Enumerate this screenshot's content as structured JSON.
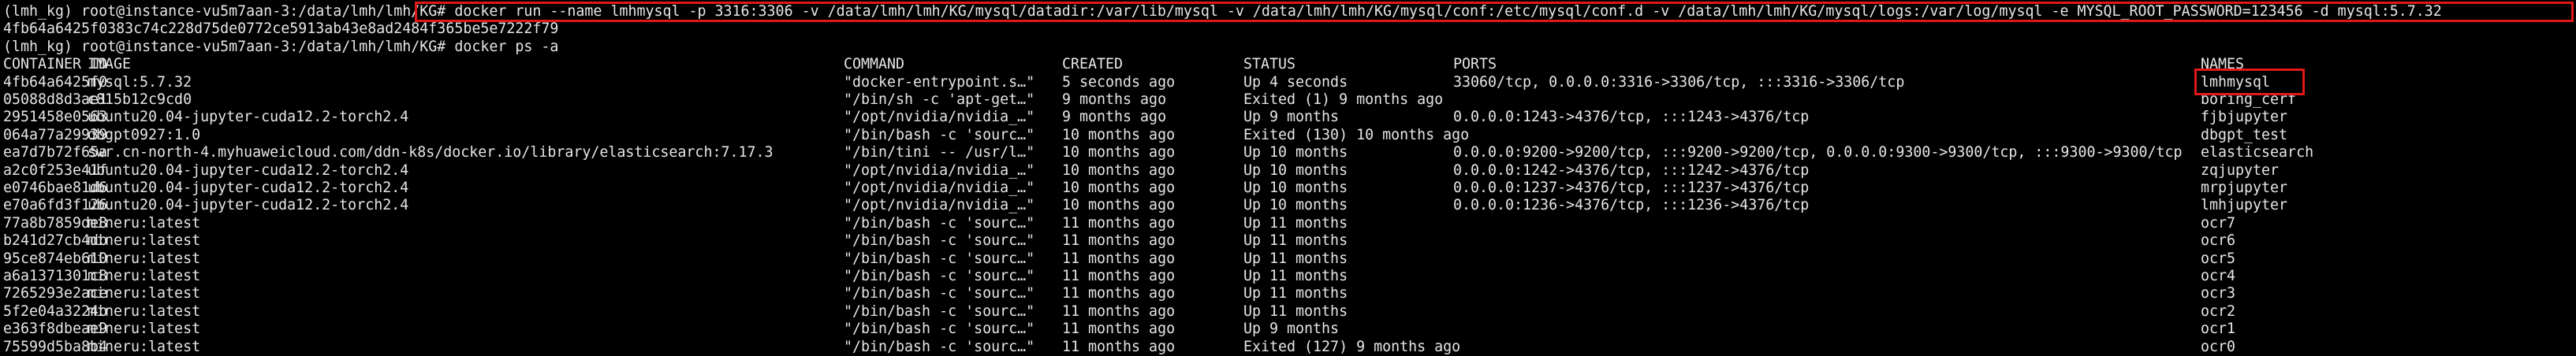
{
  "terminal": {
    "highlight_color": "#e01818",
    "line1_prompt": "(lmh_kg) root@instance-vu5m7aan-3:/data/lmh/lmh/KG# ",
    "line1_command": "docker run --name lmhmysql -p 3316:3306 -v /data/lmh/lmh/KG/mysql/datadir:/var/lib/mysql -v /data/lmh/lmh/KG/mysql/conf:/etc/mysql/conf.d -v /data/lmh/lmh/KG/mysql/logs:/var/log/mysql -e MYSQL_ROOT_PASSWORD=123456 -d mysql:5.7.32",
    "container_hash": "4fb64a6425f0383c74c228d75de0772ce5913ab43e8ad2484f365be5e7222f79",
    "line3": "(lmh_kg) root@instance-vu5m7aan-3:/data/lmh/lmh/KG# docker ps -a",
    "columns": [
      "CONTAINER ID",
      "IMAGE",
      "COMMAND",
      "CREATED",
      "STATUS",
      "PORTS",
      "NAMES"
    ],
    "rows": [
      [
        "4fb64a6425f0",
        "mysql:5.7.32",
        "\"docker-entrypoint.s…\"",
        "5 seconds ago",
        "Up 4 seconds",
        "33060/tcp, 0.0.0.0:3316->3306/tcp, :::3316->3306/tcp",
        "lmhmysql"
      ],
      [
        "05088d8d3ae1",
        "c815b12c9cd0",
        "\"/bin/sh -c 'apt-get…\"",
        "9 months ago",
        "Exited (1) 9 months ago",
        "",
        "boring_cerf"
      ],
      [
        "2951458e0563",
        "ubuntu20.04-jupyter-cuda12.2-torch2.4",
        "\"/opt/nvidia/nvidia_…\"",
        "9 months ago",
        "Up 9 months",
        "0.0.0.0:1243->4376/tcp, :::1243->4376/tcp",
        "fjbjupyter"
      ],
      [
        "064a77a29939",
        "dbgpt0927:1.0",
        "\"/bin/bash -c 'sourc…\"",
        "10 months ago",
        "Exited (130) 10 months ago",
        "",
        "dbgpt_test"
      ],
      [
        "ea7d7b72f65a",
        "swr.cn-north-4.myhuaweicloud.com/ddn-k8s/docker.io/library/elasticsearch:7.17.3",
        "\"/bin/tini -- /usr/l…\"",
        "10 months ago",
        "Up 10 months",
        "0.0.0.0:9200->9200/tcp, :::9200->9200/tcp, 0.0.0.0:9300->9300/tcp, :::9300->9300/tcp",
        "elasticsearch"
      ],
      [
        "a2c0f253e41f",
        "ubuntu20.04-jupyter-cuda12.2-torch2.4",
        "\"/opt/nvidia/nvidia_…\"",
        "10 months ago",
        "Up 10 months",
        "0.0.0.0:1242->4376/tcp, :::1242->4376/tcp",
        "zqjupyter"
      ],
      [
        "e0746bae81d6",
        "ubuntu20.04-jupyter-cuda12.2-torch2.4",
        "\"/opt/nvidia/nvidia_…\"",
        "10 months ago",
        "Up 10 months",
        "0.0.0.0:1237->4376/tcp, :::1237->4376/tcp",
        "mrpjupyter"
      ],
      [
        "e70a6fd3f126",
        "ubuntu20.04-jupyter-cuda12.2-torch2.4",
        "\"/opt/nvidia/nvidia_…\"",
        "10 months ago",
        "Up 10 months",
        "0.0.0.0:1236->4376/tcp, :::1236->4376/tcp",
        "lmhjupyter"
      ],
      [
        "77a8b7859de8",
        "mineru:latest",
        "\"/bin/bash -c 'sourc…\"",
        "11 months ago",
        "Up 11 months",
        "",
        "ocr7"
      ],
      [
        "b241d27cb4db",
        "mineru:latest",
        "\"/bin/bash -c 'sourc…\"",
        "11 months ago",
        "Up 11 months",
        "",
        "ocr6"
      ],
      [
        "95ce874eb610",
        "mineru:latest",
        "\"/bin/bash -c 'sourc…\"",
        "11 months ago",
        "Up 11 months",
        "",
        "ocr5"
      ],
      [
        "a6a1371301c8",
        "mineru:latest",
        "\"/bin/bash -c 'sourc…\"",
        "11 months ago",
        "Up 11 months",
        "",
        "ocr4"
      ],
      [
        "7265293e2ace",
        "mineru:latest",
        "\"/bin/bash -c 'sourc…\"",
        "11 months ago",
        "Up 11 months",
        "",
        "ocr3"
      ],
      [
        "5f2e04a3224b",
        "mineru:latest",
        "\"/bin/bash -c 'sourc…\"",
        "11 months ago",
        "Up 11 months",
        "",
        "ocr2"
      ],
      [
        "e363f8dbeae9",
        "mineru:latest",
        "\"/bin/bash -c 'sourc…\"",
        "11 months ago",
        "Up 9 months",
        "",
        "ocr1"
      ],
      [
        "75599d5ba8b4",
        "mineru:latest",
        "\"/bin/bash -c 'sourc…\"",
        "11 months ago",
        "Exited (127) 9 months ago",
        "",
        "ocr0"
      ]
    ]
  }
}
